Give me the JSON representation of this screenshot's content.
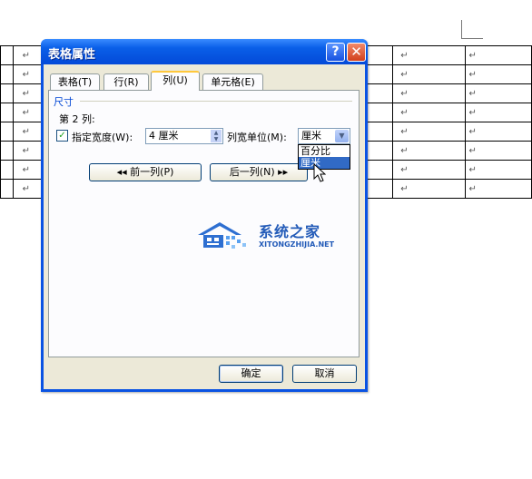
{
  "document": {
    "paragraph_mark": "↵",
    "rows": 8
  },
  "dialog": {
    "title": "表格属性",
    "help_symbol": "?",
    "close_symbol": "✕",
    "tabs": [
      {
        "label": "表格(T)",
        "active": false
      },
      {
        "label": "行(R)",
        "active": false
      },
      {
        "label": "列(U)",
        "active": true
      },
      {
        "label": "单元格(E)",
        "active": false
      }
    ],
    "column_tab": {
      "group_label": "尺寸",
      "column_label": "第 2 列:",
      "specify_width": {
        "checked": true,
        "check_mark": "✓",
        "label": "指定宽度(W):",
        "value": "4 厘米"
      },
      "unit_label": "列宽单位(M):",
      "unit_combo": {
        "value": "厘米",
        "options": [
          "百分比",
          "厘米"
        ],
        "highlighted_index": 1
      },
      "prev_button": "◂◂ 前一列(P)",
      "next_button": "后一列(N) ▸▸"
    },
    "ok_button": "确定",
    "cancel_button": "取消"
  },
  "watermark": {
    "title": "系统之家",
    "subtitle": "XITONGZHIJIA.NET"
  },
  "colors": {
    "title_bar": "#0a5fe8",
    "dialog_bg": "#ece9d8",
    "selection": "#316ac5",
    "watermark": "#235bb8"
  }
}
